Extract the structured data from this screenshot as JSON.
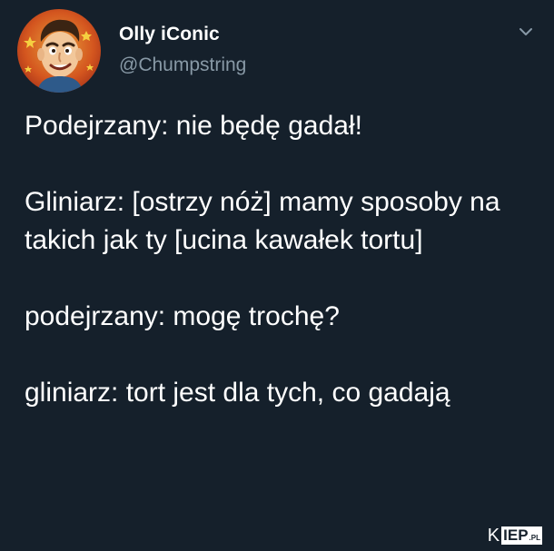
{
  "tweet": {
    "display_name": "Olly iConic",
    "handle": "@Chumpstring",
    "paragraphs": [
      "Podejrzany: nie będę gadał!",
      "Gliniarz: [ostrzy nóż] mamy sposoby na takich jak ty [ucina kawałek tortu]",
      "podejrzany: mogę trochę?",
      "gliniarz: tort jest dla tych, co gadają"
    ],
    "menu_icon": "chevron-down-icon",
    "avatar_icon": "cartoon-face-avatar"
  },
  "watermark": {
    "prefix": "K",
    "boxed": "IEP",
    "suffix": ".PL"
  },
  "colors": {
    "background": "#15202b",
    "text": "#ffffff",
    "secondary_text": "#8899a6"
  }
}
